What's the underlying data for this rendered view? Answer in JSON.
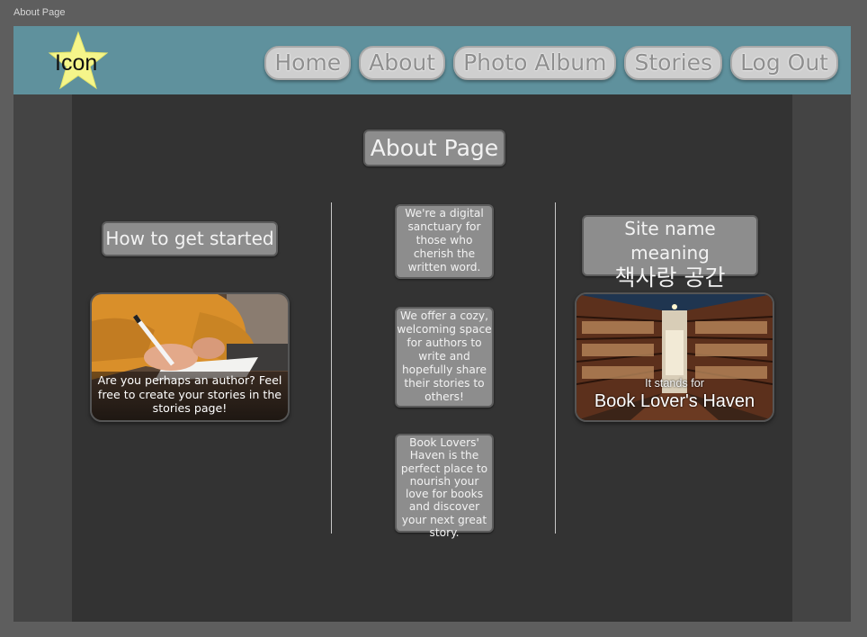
{
  "window": {
    "title": "About Page"
  },
  "header": {
    "logo_label": "Icon",
    "nav": [
      {
        "label": "Home"
      },
      {
        "label": "About"
      },
      {
        "label": "Photo Album"
      },
      {
        "label": "Stories"
      },
      {
        "label": "Log Out"
      }
    ]
  },
  "main": {
    "title": "About Page",
    "left": {
      "heading": "How to get started",
      "card_caption": "Are you perhaps an author? Feel free to create your stories in the stories page!"
    },
    "center": {
      "blurbs": [
        "We're a digital sanctuary for those who cherish the written word.",
        "We offer a cozy, welcoming space for authors to write and hopefully share their stories to others!",
        "Book Lovers' Haven is the perfect place to nourish your love for books and discover your next great story."
      ]
    },
    "right": {
      "heading": "Site name meaning",
      "heading_korean": "책사랑 공간",
      "card_small": "It stands for",
      "card_big": "Book Lover's Haven"
    }
  },
  "colors": {
    "header": "#5f919d",
    "panel": "#333333",
    "star": "#f5f58a"
  }
}
